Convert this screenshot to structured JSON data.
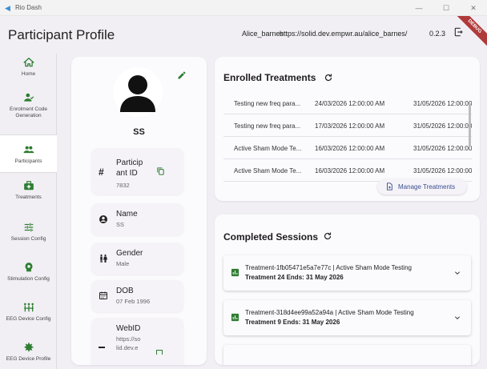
{
  "window": {
    "app_name": "Rio Dash",
    "minimize": "—",
    "maximize": "☐",
    "close": "✕"
  },
  "appbar": {
    "title": "Participant Profile",
    "user": "Alice_barnes",
    "url": "https://solid.dev.empwr.au/alice_barnes/",
    "version": "0.2.3",
    "debug_banner": "DEBUG"
  },
  "sidebar": {
    "items": [
      {
        "label": "Home",
        "icon": "home-icon"
      },
      {
        "label": "Enrolment Code Generation",
        "icon": "person-add-icon"
      },
      {
        "label": "Participants",
        "icon": "group-icon"
      },
      {
        "label": "Treatments",
        "icon": "medical-kit-icon"
      },
      {
        "label": "Session Config",
        "icon": "tune-icon"
      },
      {
        "label": "Stimulation Config",
        "icon": "stimulation-icon"
      },
      {
        "label": "EEG Device Config",
        "icon": "device-hub-icon"
      },
      {
        "label": "EEG Device Profile",
        "icon": "settings-icon"
      }
    ]
  },
  "profile": {
    "name": "SS",
    "fields": [
      {
        "label_line1": "Particip",
        "label_line2": "ant ID",
        "value": "7832",
        "icon": "hash-icon"
      },
      {
        "label": "Name",
        "value": "SS",
        "icon": "account-circle-icon"
      },
      {
        "label": "Gender",
        "value": "Male",
        "icon": "wc-icon"
      },
      {
        "label": "DOB",
        "value": "07 Feb 1996",
        "icon": "calendar-icon"
      },
      {
        "label": "WebID",
        "value_line1": "https://so",
        "value_line2": "lid.dev.e",
        "icon": "link-icon"
      }
    ]
  },
  "treatments": {
    "title": "Enrolled Treatments",
    "rows": [
      {
        "name": "Testing new freq para...",
        "start": "24/03/2026 12:00:00 AM",
        "end": "31/05/2026 12:00:00 ."
      },
      {
        "name": "Testing new freq para...",
        "start": "17/03/2026 12:00:00 AM",
        "end": "31/05/2026 12:00:00 ."
      },
      {
        "name": "Active Sham Mode Te...",
        "start": "16/03/2026 12:00:00 AM",
        "end": "31/05/2026 12:00:00 ."
      },
      {
        "name": "Active Sham Mode Te...",
        "start": "16/03/2026 12:00:00 AM",
        "end": "31/05/2026 12:00:00 ."
      }
    ],
    "manage_label": "Manage Treatments"
  },
  "sessions": {
    "title": "Completed Sessions",
    "items": [
      {
        "title": "Treatment-1fb05471e5a7e77c | Active Sham Mode Testing",
        "subtitle": "Treatment 24   Ends: 31 May 2026"
      },
      {
        "title": "Treatment-318d4ee99a52a94a | Active Sham Mode Testing",
        "subtitle": "Treatment 9   Ends: 31 May 2026"
      }
    ]
  },
  "colors": {
    "accent": "#2e7d32",
    "link": "#3b4f8f",
    "background": "#f1eff4",
    "card": "#fbfafd"
  }
}
